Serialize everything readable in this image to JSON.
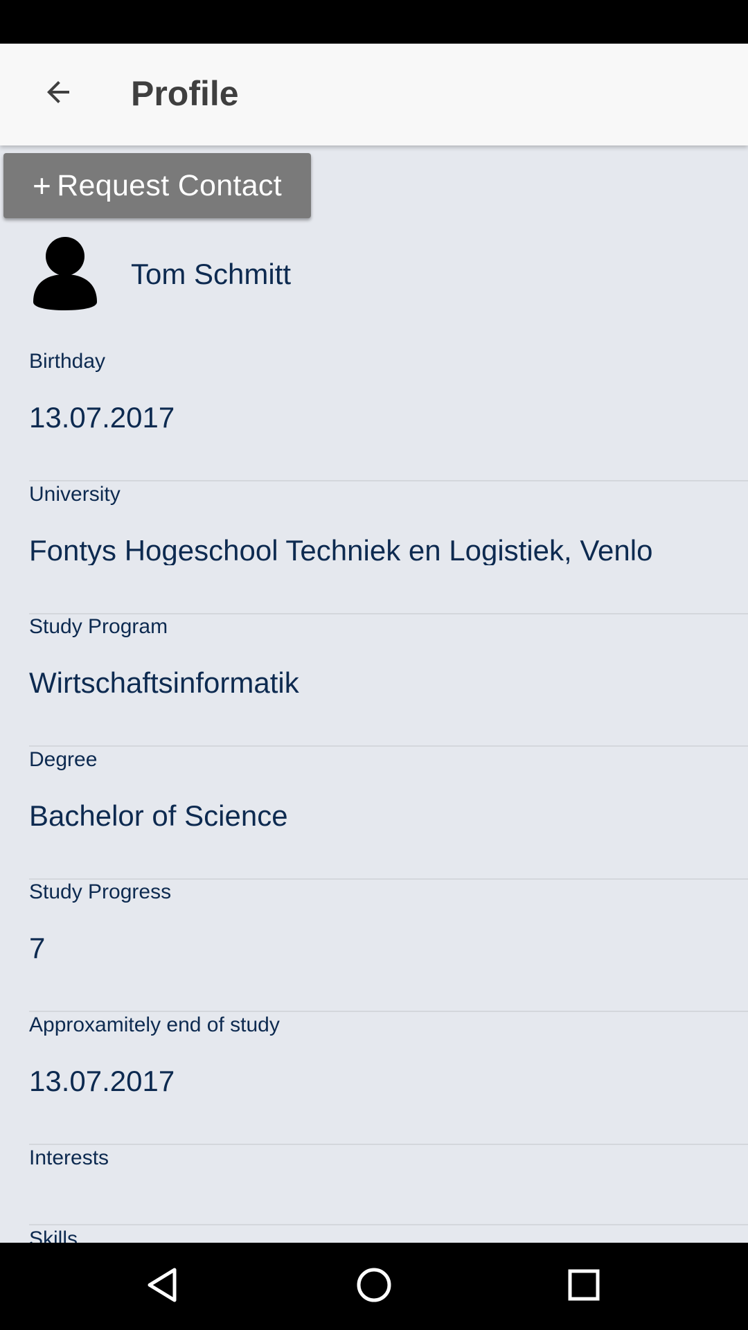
{
  "header": {
    "title": "Profile"
  },
  "actions": {
    "request_contact_plus": "+",
    "request_contact_label": "Request Contact"
  },
  "profile": {
    "name": "Tom Schmitt"
  },
  "fields": [
    {
      "label": "Birthday",
      "value": "13.07.2017"
    },
    {
      "label": "University",
      "value": "Fontys Hogeschool Techniek en Logistiek, Venlo"
    },
    {
      "label": "Study Program",
      "value": "Wirtschaftsinformatik"
    },
    {
      "label": "Degree",
      "value": "Bachelor of Science"
    },
    {
      "label": "Study Progress",
      "value": "7"
    },
    {
      "label": "Approxamitely end of study",
      "value": "13.07.2017"
    },
    {
      "label": "Interests",
      "value": ""
    },
    {
      "label": "Skills",
      "value": ""
    }
  ],
  "icons": {
    "back": "arrow-left-icon",
    "avatar": "person-icon",
    "nav_back": "triangle-back-icon",
    "nav_home": "circle-home-icon",
    "nav_recents": "square-recents-icon"
  },
  "colors": {
    "background": "#e5e8ee",
    "app_bar": "#f8f8f8",
    "text_primary": "#0d2a50",
    "button": "#7a7a7a"
  }
}
